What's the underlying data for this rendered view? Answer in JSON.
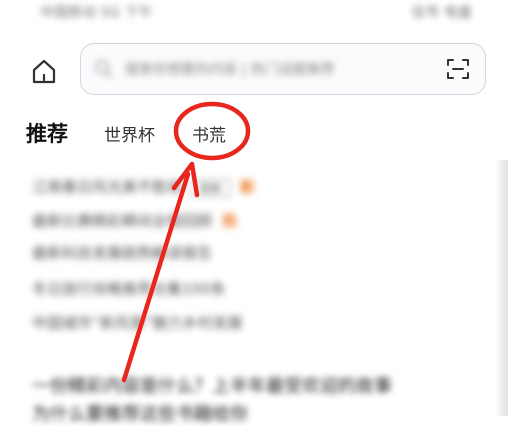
{
  "status_bar": {
    "left_text": "中国移动 5G 下午",
    "right_text": "信号 电量"
  },
  "header": {
    "home_icon": "home-icon",
    "search": {
      "placeholder": "搜索你想要的内容 | 热门话题推荐",
      "left_icon": "search-icon",
      "right_icon": "scan-icon"
    }
  },
  "tabs": [
    {
      "label": "推荐",
      "active": true
    },
    {
      "label": "世界杯",
      "active": false
    },
    {
      "label": "书荒",
      "active": false
    }
  ],
  "feed": {
    "items": [
      {
        "text": "江南春日风光美不胜收",
        "badge": "新",
        "outline": "视频"
      },
      {
        "text": "最新比赛精彩瞬间全程回顾",
        "badge": "热",
        "outline": ""
      },
      {
        "text": "最新科技发展趋势解读报告",
        "badge": "",
        "outline": ""
      },
      {
        "text": "冬日旅行攻略推荐合集100条",
        "badge": "",
        "outline": ""
      },
      {
        "text": "中国城市“新风景”魅力乡村发展",
        "badge": "",
        "outline": ""
      }
    ],
    "article_line_1": "一份精彩内容是什么？上半年最受欢迎的故事",
    "article_line_2": "为什么要推荐这些书籍给你"
  },
  "colors": {
    "annotation": "#e8261e",
    "hot_badge": "#f07b2a",
    "search_border": "#d4d6db"
  }
}
